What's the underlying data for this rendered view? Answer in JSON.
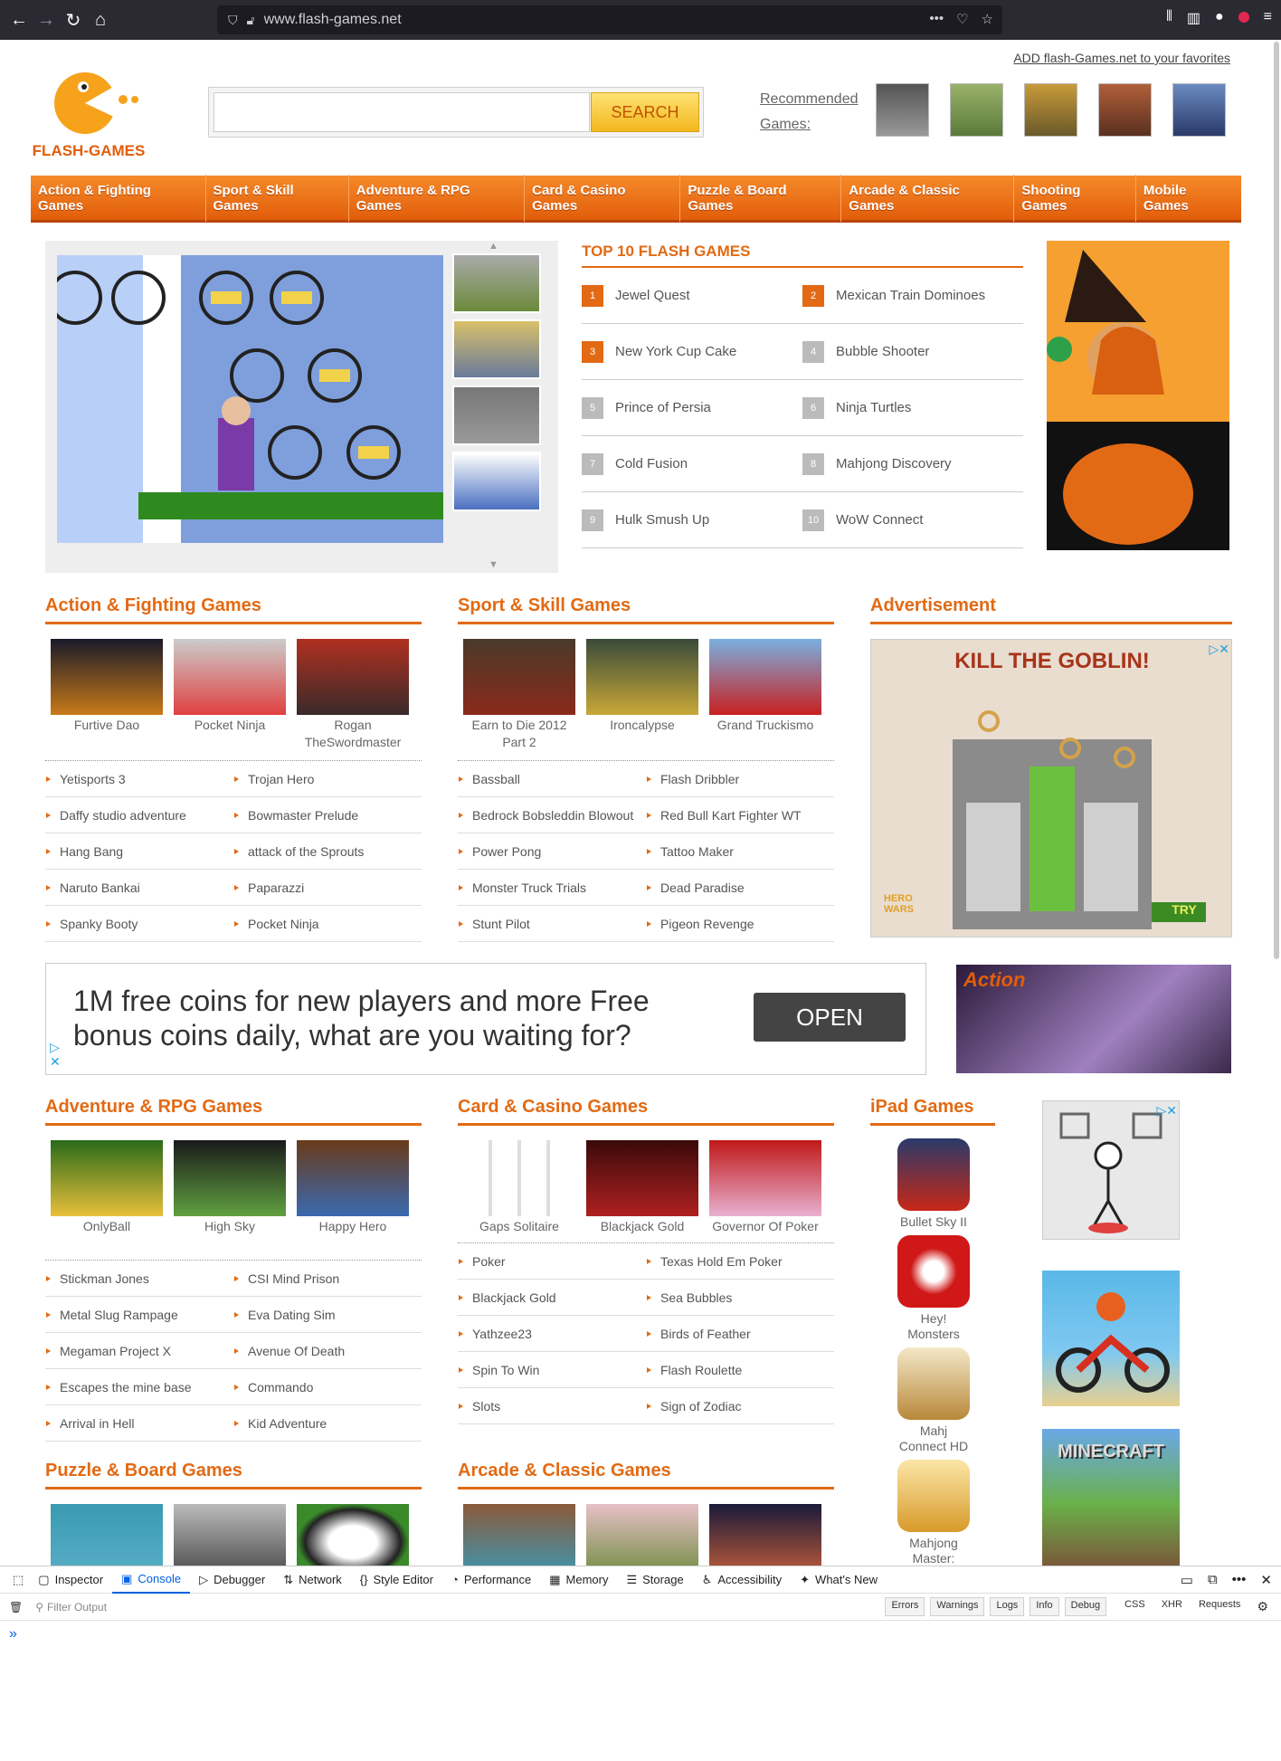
{
  "browser": {
    "url": "www.flash-games.net"
  },
  "header": {
    "favorites_link": "ADD flash-Games.net to your favorites",
    "logo_text": "FLASH-GAMES",
    "search_button": "SEARCH",
    "search_placeholder": "",
    "recommended_label_1": "Recommended",
    "recommended_label_2": "Games:"
  },
  "menu": [
    "Action & Fighting Games",
    "Sport & Skill Games",
    "Adventure & RPG Games",
    "Card & Casino Games",
    "Puzzle & Board Games",
    "Arcade & Classic Games",
    "Shooting Games",
    "Mobile Games"
  ],
  "top10": {
    "title": "TOP 10 FLASH GAMES",
    "items": [
      {
        "n": "1",
        "name": "Jewel Quest"
      },
      {
        "n": "2",
        "name": "Mexican Train Dominoes"
      },
      {
        "n": "3",
        "name": "New York Cup Cake"
      },
      {
        "n": "4",
        "name": "Bubble Shooter"
      },
      {
        "n": "5",
        "name": "Prince of Persia"
      },
      {
        "n": "6",
        "name": "Ninja Turtles"
      },
      {
        "n": "7",
        "name": "Cold Fusion"
      },
      {
        "n": "8",
        "name": "Mahjong Discovery"
      },
      {
        "n": "9",
        "name": "Hulk Smush Up"
      },
      {
        "n": "10",
        "name": "WoW Connect"
      }
    ]
  },
  "action": {
    "title": "Action & Fighting Games",
    "thumbs": [
      "Furtive Dao",
      "Pocket Ninja",
      "Rogan TheSwordmaster"
    ],
    "list": [
      "Yetisports 3",
      "Trojan Hero",
      "Daffy studio adventure",
      "Bowmaster Prelude",
      "Hang Bang",
      "attack of the Sprouts",
      "Naruto Bankai",
      "Paparazzi",
      "Spanky Booty",
      "Pocket Ninja"
    ]
  },
  "sport": {
    "title": "Sport & Skill Games",
    "thumbs": [
      "Earn to Die 2012 Part 2",
      "Ironcalypse",
      "Grand Truckismo"
    ],
    "list": [
      "Bassball",
      "Flash Dribbler",
      "Bedrock Bobsleddin Blowout",
      "Red Bull Kart Fighter WT",
      "Power Pong",
      "Tattoo Maker",
      "Monster Truck Trials",
      "Dead Paradise",
      "Stunt Pilot",
      "Pigeon Revenge"
    ]
  },
  "advertisement": {
    "title": "Advertisement",
    "ad_headline": "KILL THE GOBLIN!",
    "ad_cta": "TRY",
    "ad_brand": "HERO WARS"
  },
  "banner_ad": {
    "text_line1": "1M free coins for new players and more Free",
    "text_line2": "bonus coins daily, what are you waiting for?",
    "button": "OPEN"
  },
  "action_banner": {
    "label": "Action"
  },
  "adventure": {
    "title": "Adventure & RPG Games",
    "thumbs": [
      "OnlyBall",
      "High Sky",
      "Happy Hero"
    ],
    "list": [
      "Stickman Jones",
      "CSI Mind Prison",
      "Metal Slug Rampage",
      "Eva Dating Sim",
      "Megaman Project X",
      "Avenue Of Death",
      "Escapes the mine base",
      "Commando",
      "Arrival in Hell",
      "Kid Adventure"
    ]
  },
  "card": {
    "title": "Card & Casino Games",
    "thumbs": [
      "Gaps Solitaire",
      "Blackjack Gold",
      "Governor Of Poker"
    ],
    "list": [
      "Poker",
      "Texas Hold Em Poker",
      "Blackjack Gold",
      "Sea Bubbles",
      "Yathzee23",
      "Birds of Feather",
      "Spin To Win",
      "Flash Roulette",
      "Slots",
      "Sign of Zodiac"
    ]
  },
  "ipad": {
    "title": "iPad Games",
    "items": [
      "Bullet Sky II",
      "Hey! Monsters",
      "Mahj Connect HD",
      "Mahjong Master:"
    ]
  },
  "puzzle": {
    "title": "Puzzle & Board Games"
  },
  "arcade": {
    "title": "Arcade & Classic Games"
  },
  "side_ads": {
    "minecraft": "MINECRAFT"
  },
  "devtools": {
    "tabs": [
      "Inspector",
      "Console",
      "Debugger",
      "Network",
      "Style Editor",
      "Performance",
      "Memory",
      "Storage",
      "Accessibility",
      "What's New"
    ],
    "filter_placeholder": "Filter Output",
    "filters": [
      "Errors",
      "Warnings",
      "Logs",
      "Info",
      "Debug"
    ],
    "extra": [
      "CSS",
      "XHR",
      "Requests"
    ]
  },
  "colors": {
    "accent": "#e26a14",
    "menu_top": "#f58a2a",
    "menu_bottom": "#e25d0a"
  }
}
